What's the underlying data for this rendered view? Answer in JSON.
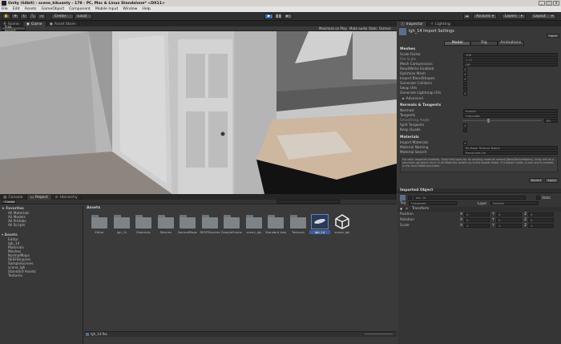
{
  "window": {
    "title": "Unity (64bit) - scene_kikuanty - 178 - PC, Mac & Linux Standalone* <DX11>",
    "buttons": [
      "_",
      "□",
      "×"
    ]
  },
  "menu": [
    "File",
    "Edit",
    "Assets",
    "GameObject",
    "Component",
    "Mobile Input",
    "Window",
    "Help"
  ],
  "toolbar": {
    "pivot": "Center",
    "space": "Local",
    "account": "Account",
    "layers": "Layers",
    "layout": "Layout"
  },
  "scene_tabs": [
    "Scene",
    "Game",
    "Asset Store"
  ],
  "scene_bar": {
    "aspect": "Free Aspect",
    "items": [
      "Maximize on Play",
      "Mute audio",
      "Stats",
      "Gizmos"
    ]
  },
  "inspector": {
    "tabs": [
      "Inspector",
      "Lighting"
    ],
    "title": "lgh_14 Import Settings",
    "open": "Open",
    "subtabs": [
      "Model",
      "Rig",
      "Animations"
    ],
    "meshes_header": "Meshes",
    "scale_factor": {
      "label": "Scale Factor",
      "value": "100"
    },
    "file_scale": {
      "label": "File Scale",
      "value": "0.01"
    },
    "mesh_compression": {
      "label": "Mesh Compression",
      "value": "Off"
    },
    "checks": [
      {
        "label": "Read/Write Enabled",
        "checked": "✓"
      },
      {
        "label": "Optimize Mesh",
        "checked": "✓"
      },
      {
        "label": "Import BlendShapes",
        "checked": "✓"
      },
      {
        "label": "Generate Colliders",
        "checked": ""
      },
      {
        "label": "Swap UVs",
        "checked": ""
      },
      {
        "label": "Generate Lightmap UVs",
        "checked": "✓"
      }
    ],
    "advanced": "► Advanced",
    "normals_header": "Normals & Tangents",
    "normals": {
      "label": "Normals",
      "value": "Import"
    },
    "tangents": {
      "label": "Tangents",
      "value": "Calculate"
    },
    "smoothing": {
      "label": "Smoothing Angle",
      "value": "60"
    },
    "split_tangents": {
      "label": "Split Tangents",
      "checked": "✓"
    },
    "keep_quads": {
      "label": "Keep Quads",
      "checked": ""
    },
    "materials_header": "Materials",
    "import_materials": {
      "label": "Import Materials",
      "checked": "✓"
    },
    "material_naming": {
      "label": "Material Naming",
      "value": "By Base Texture Name"
    },
    "material_search": {
      "label": "Material Search",
      "value": "Recursive-Up"
    },
    "help": "For each imported material, Unity first looks for an existing material named [BaseTextureName]. Unity will do a recursive-up search for it in all Materials folders up to the Assets folder. If it doesn't exist, a new one is created in the local Materials folder.",
    "revert": "Revert",
    "apply": "Apply",
    "imported_header": "Imported Object",
    "object_name": "lgh_14",
    "static": "Static",
    "tag_label": "Tag",
    "tag": "Untagged",
    "layer_label": "Layer",
    "layer": "Default",
    "transform": "Transform",
    "transform_rows": [
      {
        "label": "Position",
        "x": "0",
        "y": "0",
        "z": "0"
      },
      {
        "label": "Rotation",
        "x": "0",
        "y": "0",
        "z": "0"
      },
      {
        "label": "Scale",
        "x": "1",
        "y": "1",
        "z": "1"
      }
    ]
  },
  "bottom_tabs": [
    "Console",
    "Project",
    "Hierarchy"
  ],
  "project": {
    "create": "Create",
    "favorites": "Favorites",
    "fav_items": [
      "All Materials",
      "All Models",
      "All Prefabs",
      "All Scripts"
    ],
    "assets": "Assets",
    "tree": [
      "Editor",
      "lgh_14",
      "Materials",
      "Meshes",
      "NormalMaps",
      "RESFBinaries",
      "SampleScenes",
      "scene_lgh",
      "Standard Assets",
      "Textures"
    ],
    "breadcrumb": "Assets",
    "items": [
      "Editor",
      "lgh_14",
      "Materials",
      "Meshes",
      "NormalMaps",
      "RESFBinaries",
      "SampleScenes",
      "scene_lgh",
      "Standard Assets",
      "Textures",
      "lgh_14",
      "scene_lgh"
    ],
    "status": "lgh_14.fbx"
  }
}
